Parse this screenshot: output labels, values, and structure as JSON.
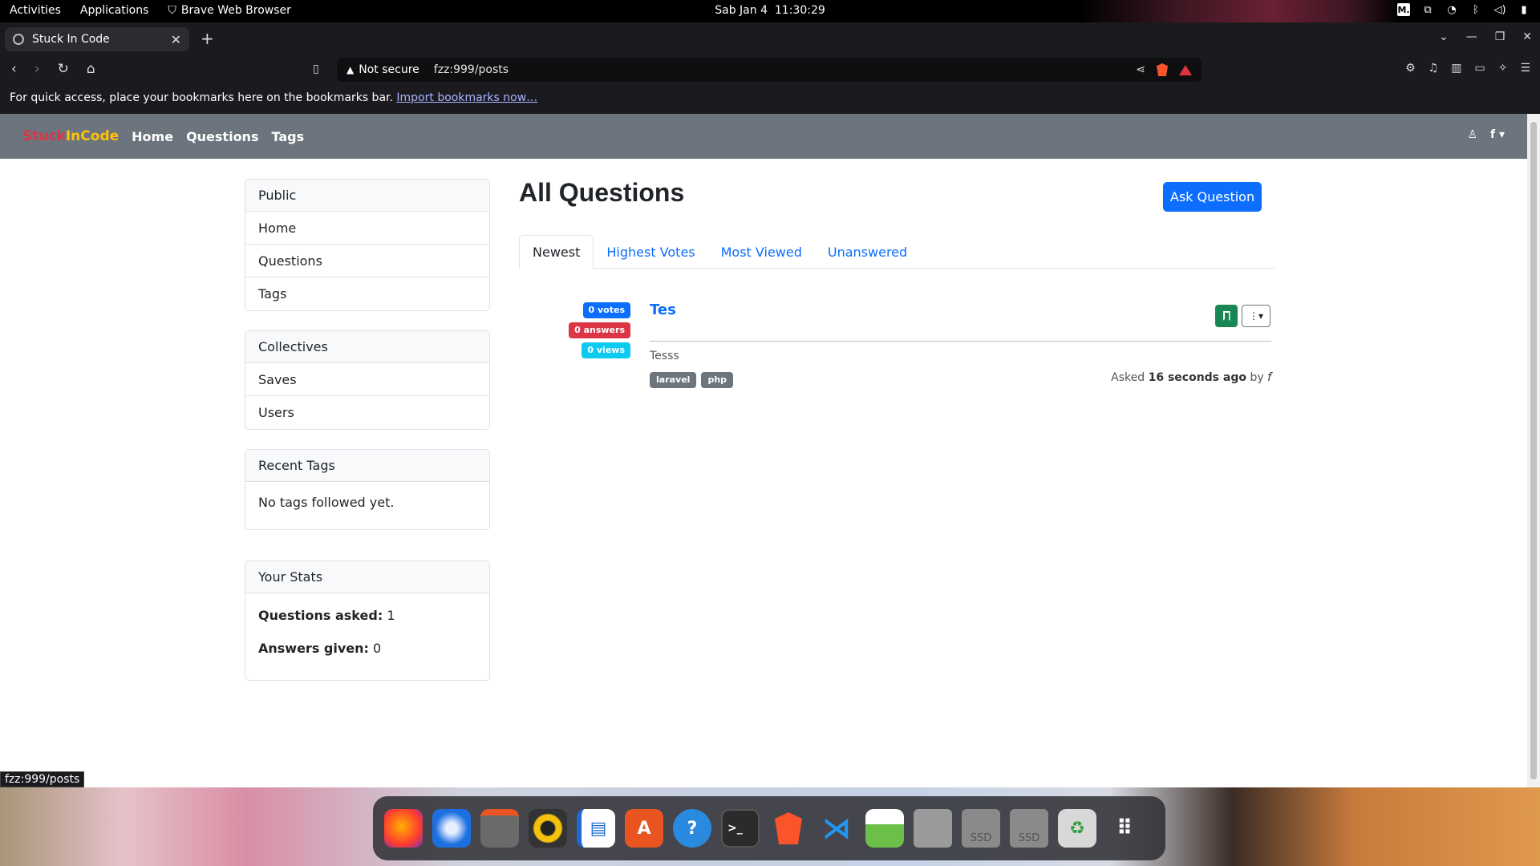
{
  "system_bar": {
    "activities": "Activities",
    "applications": "Applications",
    "active_app": "Brave Web Browser",
    "clock": "Sab Jan 4  11:30:29",
    "indicator_badge": "M."
  },
  "browser": {
    "tab_title": "Stuck In Code",
    "security_label": "Not secure",
    "url": "fzz:999/posts",
    "bookmarks_bar_text": "For quick access, place your bookmarks here on the bookmarks bar.",
    "bookmarks_bar_link": "Import bookmarks now…",
    "status_url": "fzz:999/posts"
  },
  "site": {
    "brand_part1": "Stuck",
    "brand_part2": "InCode",
    "nav": [
      "Home",
      "Questions",
      "Tags"
    ],
    "user_initial": "f"
  },
  "sidebar": {
    "public": {
      "header": "Public",
      "items": [
        "Home",
        "Questions",
        "Tags"
      ]
    },
    "collectives": {
      "header": "Collectives",
      "items": [
        "Saves",
        "Users"
      ]
    },
    "recent_tags": {
      "header": "Recent Tags",
      "empty_text": "No tags followed yet."
    },
    "stats": {
      "header": "Your Stats",
      "questions_label": "Questions asked:",
      "questions_value": "1",
      "answers_label": "Answers given:",
      "answers_value": "0"
    }
  },
  "main": {
    "title": "All Questions",
    "ask_button": "Ask Question",
    "tabs": [
      "Newest",
      "Highest Votes",
      "Most Viewed",
      "Unanswered"
    ],
    "active_tab": "Newest",
    "questions": [
      {
        "votes": "0 votes",
        "answers": "0 answers",
        "views": "0 views",
        "title": "Tes",
        "excerpt": "Tesss",
        "tags": [
          "laravel",
          "php"
        ],
        "asked_prefix": "Asked",
        "asked_time": "16 seconds ago",
        "by_label": "by",
        "author": "f"
      }
    ]
  },
  "colors": {
    "primary": "#0d6efd",
    "danger": "#dc3545",
    "info": "#0dcaf0",
    "success": "#198754",
    "secondary": "#6c757d",
    "brand_red": "#dc3545",
    "brand_yellow": "#ffc107"
  },
  "dock": {
    "apps": [
      "firefox-icon",
      "thunderbird-icon",
      "files-icon",
      "rhythmbox-icon",
      "writer-icon",
      "app-center-icon",
      "help-icon",
      "terminal-icon",
      "brave-icon",
      "vscode-icon",
      "image-viewer-icon",
      "disk-icon",
      "ssd-icon",
      "ssd-icon",
      "trash-icon",
      "app-grid-icon"
    ],
    "ssd_label": "SSD"
  }
}
